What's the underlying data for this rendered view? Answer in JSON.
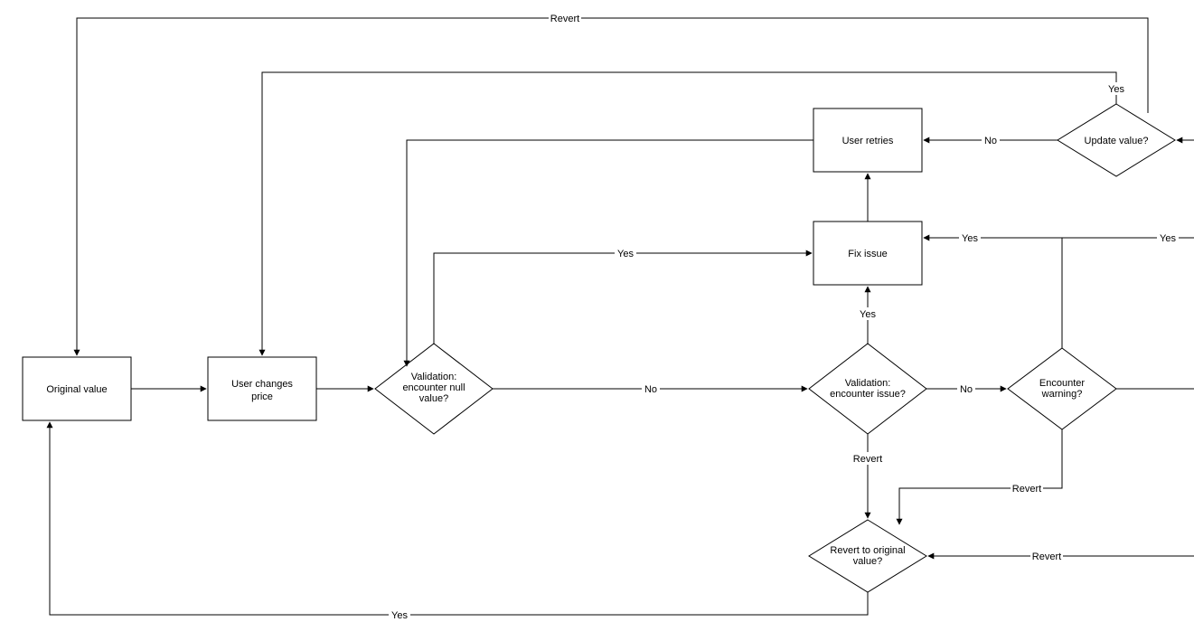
{
  "nodes": {
    "original_value": "Original value",
    "user_changes_price": {
      "l1": "User changes",
      "l2": "price"
    },
    "validation_null": {
      "l1": "Validation:",
      "l2": "encounter null",
      "l3": "value?"
    },
    "validation_issue": {
      "l1": "Validation:",
      "l2": "encounter issue?"
    },
    "encounter_warning": {
      "l1": "Encounter",
      "l2": "warning?"
    },
    "fix_issue": "Fix issue",
    "user_retries": "User retries",
    "update_value": "Update value?",
    "revert_original": {
      "l1": "Revert to original",
      "l2": "value?"
    }
  },
  "labels": {
    "yes": "Yes",
    "no": "No",
    "revert": "Revert"
  }
}
